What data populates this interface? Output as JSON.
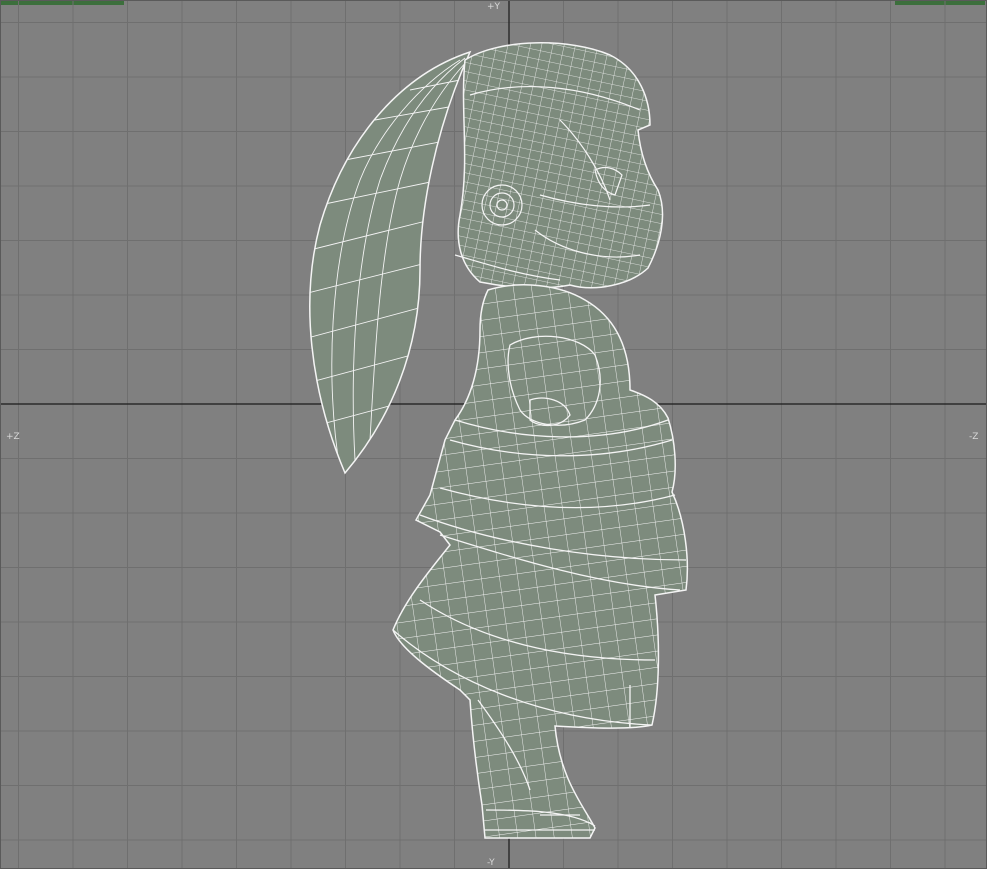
{
  "viewport": {
    "view": "side",
    "axis_labels": {
      "top": "+Y",
      "bottom": "-Y",
      "left": "+Z",
      "right": "-Z"
    },
    "grid": true,
    "model": "character-wireframe"
  },
  "colors": {
    "background": "#808080",
    "grid_line": "#6f6f6f",
    "axis_line": "#1a1a1a",
    "mesh_fill": "#7d8b7d",
    "wire": "#f4f4f4",
    "corner_accent": "#3c6f3c"
  }
}
